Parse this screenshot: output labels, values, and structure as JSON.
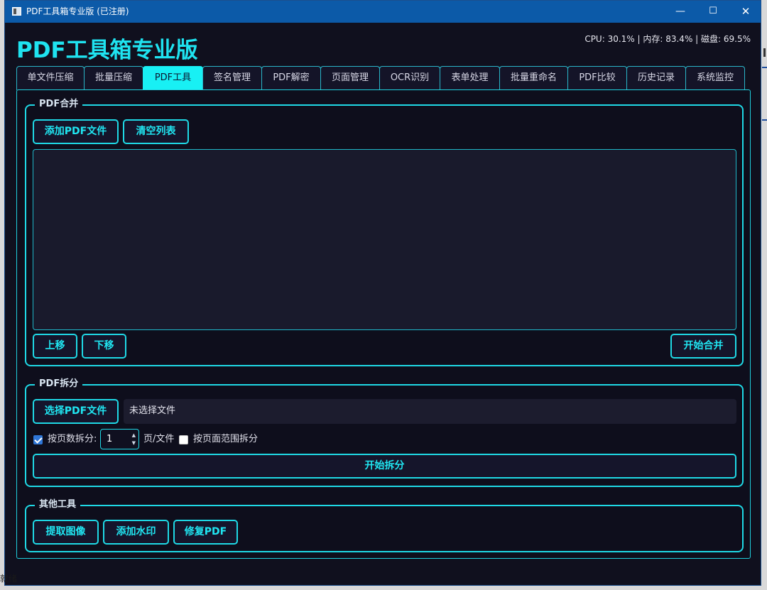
{
  "window": {
    "title": "PDF工具箱专业版 (已注册)",
    "minimize_glyph": "—",
    "maximize_glyph": "☐",
    "close_glyph": "✕"
  },
  "header": {
    "app_title": "PDF工具箱专业版",
    "system_stats": "CPU: 30.1% | 内存: 83.4% | 磁盘: 69.5%"
  },
  "tabs": [
    {
      "label": "单文件压缩"
    },
    {
      "label": "批量压缩"
    },
    {
      "label": "PDF工具",
      "active": true
    },
    {
      "label": "签名管理"
    },
    {
      "label": "PDF解密"
    },
    {
      "label": "页面管理"
    },
    {
      "label": "OCR识别"
    },
    {
      "label": "表单处理"
    },
    {
      "label": "批量重命名"
    },
    {
      "label": "PDF比较"
    },
    {
      "label": "历史记录"
    },
    {
      "label": "系统监控"
    }
  ],
  "merge": {
    "title": "PDF合并",
    "add_button": "添加PDF文件",
    "clear_button": "清空列表",
    "move_up_button": "上移",
    "move_down_button": "下移",
    "start_button": "开始合并"
  },
  "split": {
    "title": "PDF拆分",
    "select_button": "选择PDF文件",
    "file_status": "未选择文件",
    "by_pages_label": "按页数拆分:",
    "by_pages_checked": true,
    "pages_value": "1",
    "per_file_label": "页/文件",
    "by_range_label": "按页面范围拆分",
    "by_range_checked": false,
    "start_button": "开始拆分"
  },
  "other": {
    "title": "其他工具",
    "extract_button": "提取图像",
    "watermark_button": "添加水印",
    "repair_button": "修复PDF"
  },
  "statusbar": {
    "text": "就绪"
  },
  "colors": {
    "accent": "#1fe3f0",
    "background": "#10101e",
    "titlebar": "#0c5aa8",
    "active_tab": "#18f0f4"
  }
}
